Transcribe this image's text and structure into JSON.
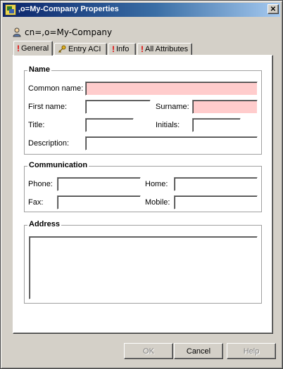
{
  "window": {
    "title": ",o=My-Company Properties",
    "close_symbol": "✕"
  },
  "object": {
    "icon": "user-icon",
    "name": "cn=,o=My-Company"
  },
  "tabs": [
    {
      "label": "General",
      "icon": "exclamation-icon",
      "active": true
    },
    {
      "label": "Entry ACI",
      "icon": "key-icon",
      "active": false
    },
    {
      "label": "Info",
      "icon": "exclamation-icon",
      "active": false
    },
    {
      "label": "All Attributes",
      "icon": "exclamation-icon",
      "active": false
    }
  ],
  "name_group": {
    "title": "Name",
    "common_name": {
      "label": "Common name:",
      "value": "",
      "required": true
    },
    "first_name": {
      "label": "First name:",
      "value": ""
    },
    "surname": {
      "label": "Surname:",
      "value": "",
      "required": true
    },
    "title_field": {
      "label": "Title:",
      "value": ""
    },
    "initials": {
      "label": "Initials:",
      "value": ""
    },
    "description": {
      "label": "Description:",
      "value": ""
    }
  },
  "communication_group": {
    "title": "Communication",
    "phone": {
      "label": "Phone:",
      "value": ""
    },
    "home": {
      "label": "Home:",
      "value": ""
    },
    "fax": {
      "label": "Fax:",
      "value": ""
    },
    "mobile": {
      "label": "Mobile:",
      "value": ""
    }
  },
  "address_group": {
    "title": "Address",
    "value": ""
  },
  "buttons": {
    "ok": "OK",
    "cancel": "Cancel",
    "help": "Help"
  },
  "colors": {
    "required_field": "#ffcccc",
    "title_bar_start": "#0a246a",
    "title_bar_end": "#a6caf0",
    "error_mark": "#e00000"
  }
}
